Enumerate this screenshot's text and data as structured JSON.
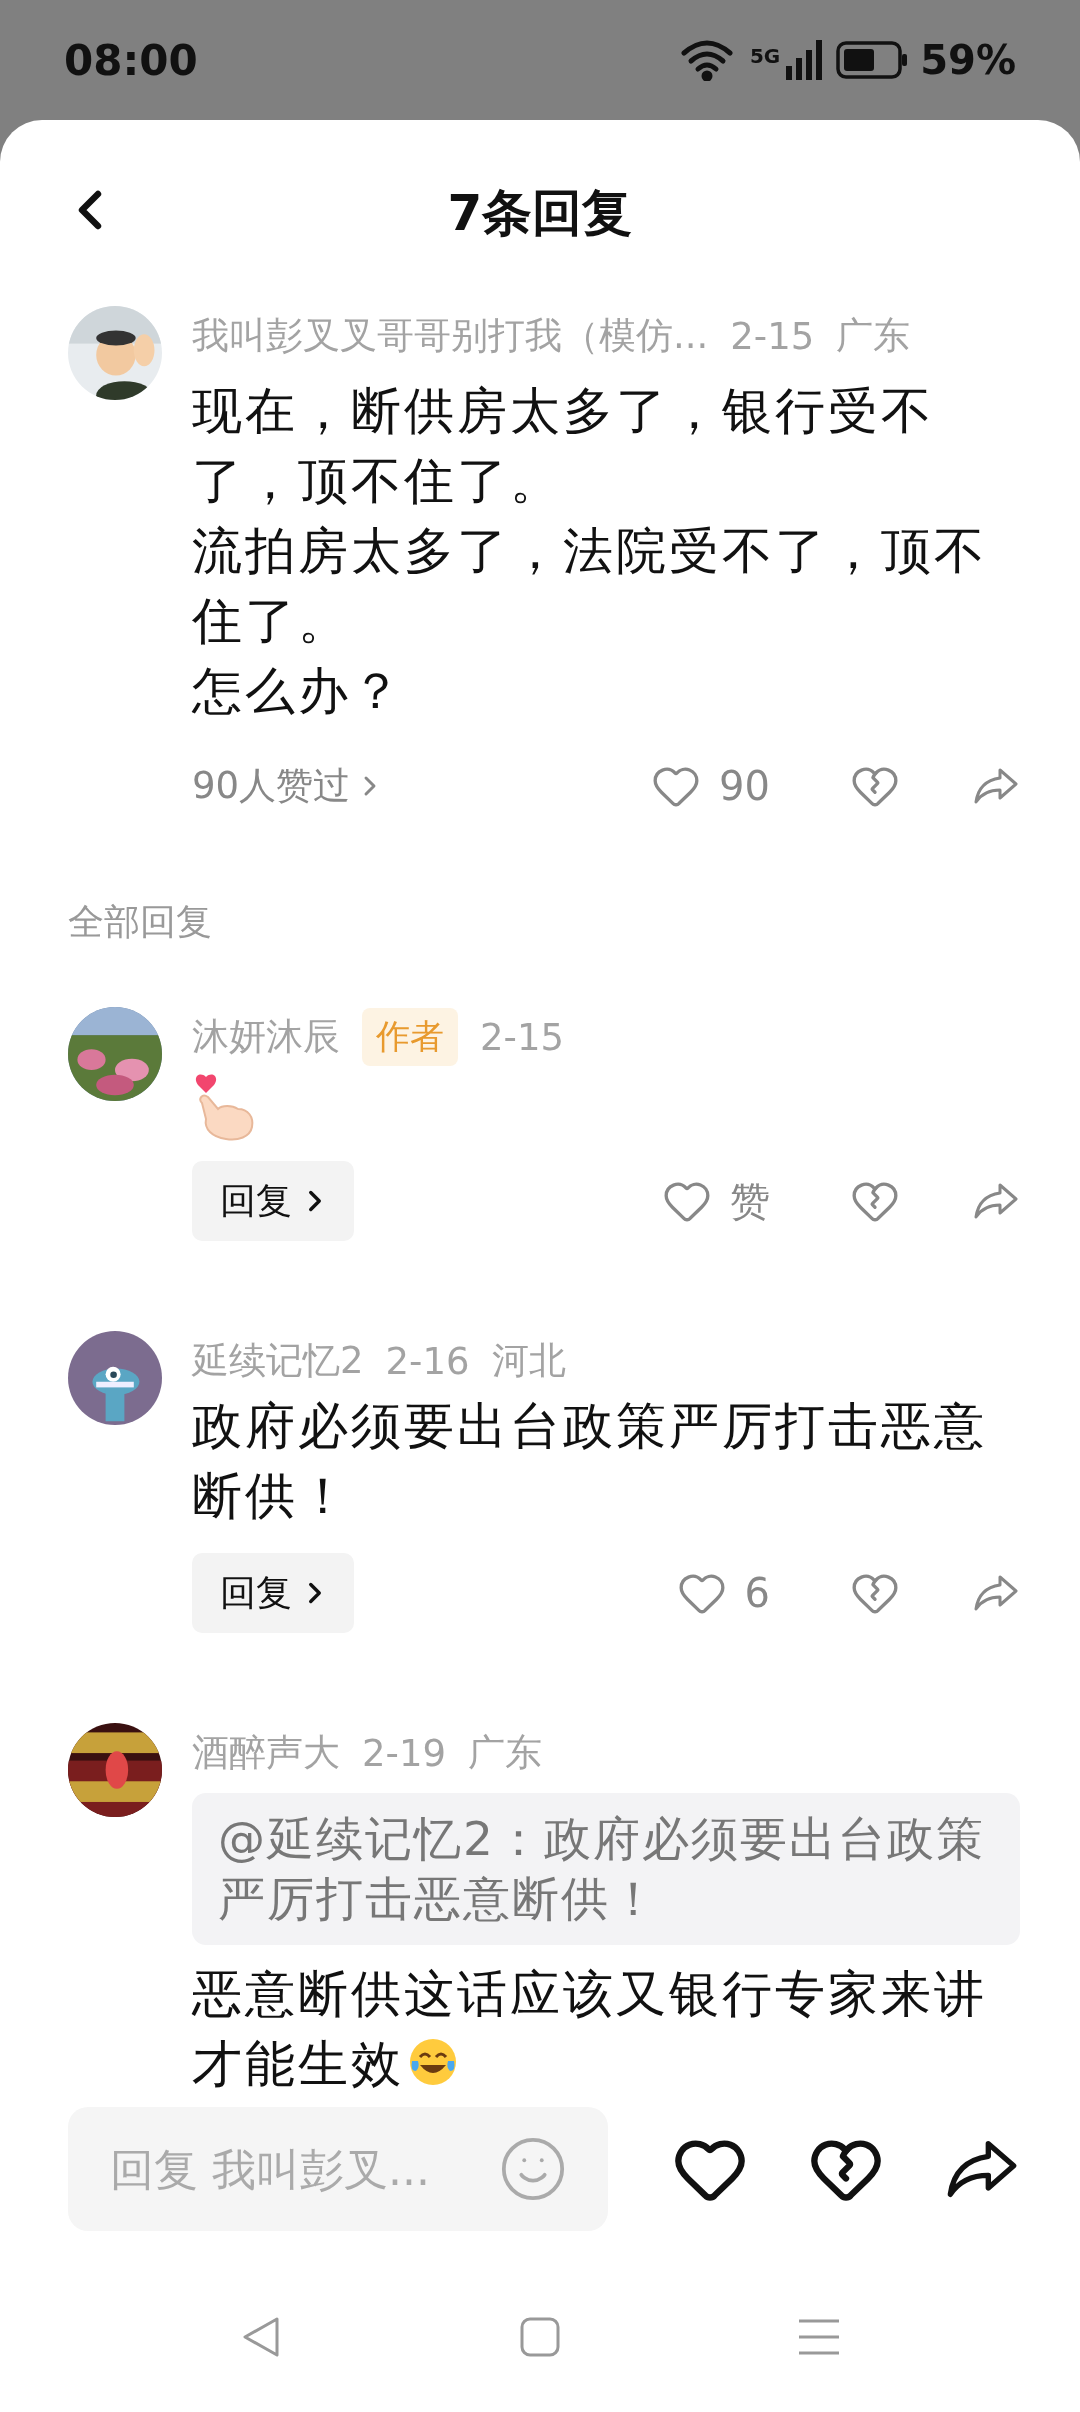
{
  "status_bar": {
    "time": "08:00",
    "network": "5G",
    "battery": "59%"
  },
  "header": {
    "title": "7条回复"
  },
  "main_comment": {
    "author": "我叫彭叉叉哥哥别打我（模仿...",
    "date": "2-15",
    "region": "广东",
    "paragraphs": [
      "现在，断供房太多了，银行受不了，顶不住了。",
      "流拍房太多了，法院受不了，顶不住了。",
      "怎么办？"
    ],
    "likers": "90人赞过",
    "likes": "90"
  },
  "section_label": "全部回复",
  "replies": [
    {
      "kind": "sticker",
      "author": "沐妍沐辰",
      "badge": "作者",
      "date": "2-15",
      "reply_label": "回复",
      "likes": "赞"
    },
    {
      "kind": "text",
      "author": "延续记忆2",
      "date": "2-16",
      "region": "河北",
      "body": "政府必须要出台政策严厉打击恶意断供！",
      "reply_label": "回复",
      "likes": "6"
    },
    {
      "kind": "text",
      "author": "酒醉声大",
      "date": "2-19",
      "region": "广东",
      "quote": "@延续记忆2：政府必须要出台政策严厉打击恶意断供！",
      "body": "恶意断供这话应该又银行专家来讲才能生效",
      "ends_with_emoji": true
    }
  ],
  "input": {
    "placeholder": "回复 我叫彭叉..."
  }
}
